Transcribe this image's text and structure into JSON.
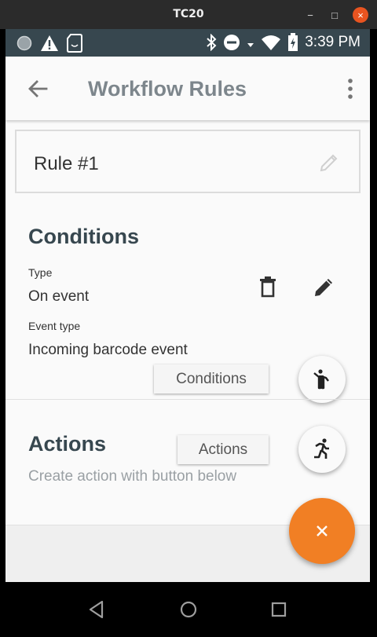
{
  "window": {
    "title": "TC20",
    "minimize": "−",
    "maximize": "□",
    "close": "×"
  },
  "statusbar": {
    "time": "3:39 PM"
  },
  "appbar": {
    "title": "Workflow Rules"
  },
  "rule": {
    "name": "Rule #1"
  },
  "conditions": {
    "heading": "Conditions",
    "type_label": "Type",
    "type_value": "On event",
    "event_type_label": "Event type",
    "event_type_value": "Incoming barcode event",
    "button_label": "Conditions"
  },
  "actions": {
    "heading": "Actions",
    "button_label": "Actions",
    "hint": "Create action with button below"
  },
  "colors": {
    "statusbar": "#37474f",
    "accent": "#f17f24",
    "title_text": "#7d868c",
    "heading_text": "#37474f"
  },
  "icons": {
    "back": "arrow-left-icon",
    "more": "more-vert-icon",
    "edit": "pencil-icon",
    "delete": "trash-icon",
    "conditions_fab": "person-standing-icon",
    "actions_fab": "person-running-icon",
    "main_fab": "close-icon"
  }
}
